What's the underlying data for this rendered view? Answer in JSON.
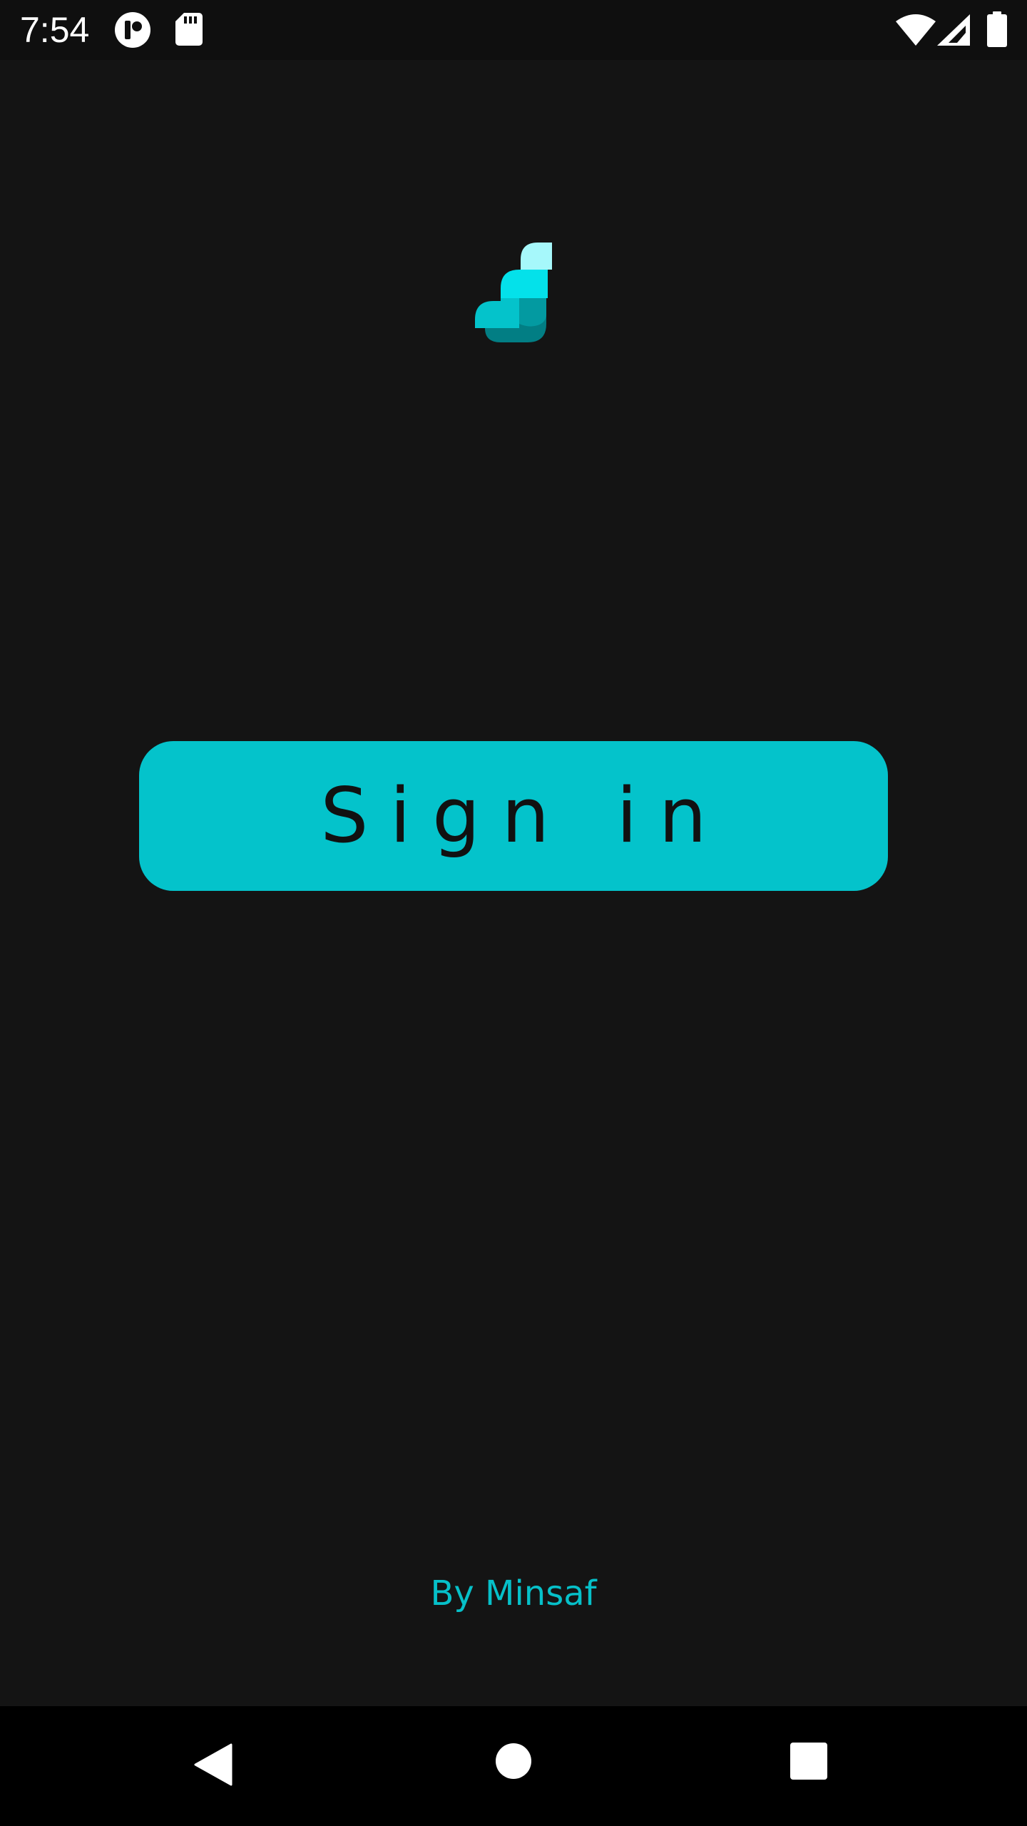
{
  "status_bar": {
    "time": "7:54",
    "icons": [
      "app-notification-icon",
      "sd-card-icon",
      "wifi-icon",
      "cell-signal-icon",
      "battery-icon"
    ]
  },
  "logo": {
    "icon": "app-logo-icon",
    "colors": [
      "#a6f8fb",
      "#04e1ea",
      "#04c3cb",
      "#039aa1",
      "#027e84"
    ]
  },
  "main": {
    "sign_in_label": "Sign in",
    "accent_color": "#04c3cb"
  },
  "footer": {
    "credit": "By Minsaf"
  },
  "nav_bar": {
    "buttons": [
      "back-icon",
      "home-icon",
      "recents-icon"
    ]
  }
}
